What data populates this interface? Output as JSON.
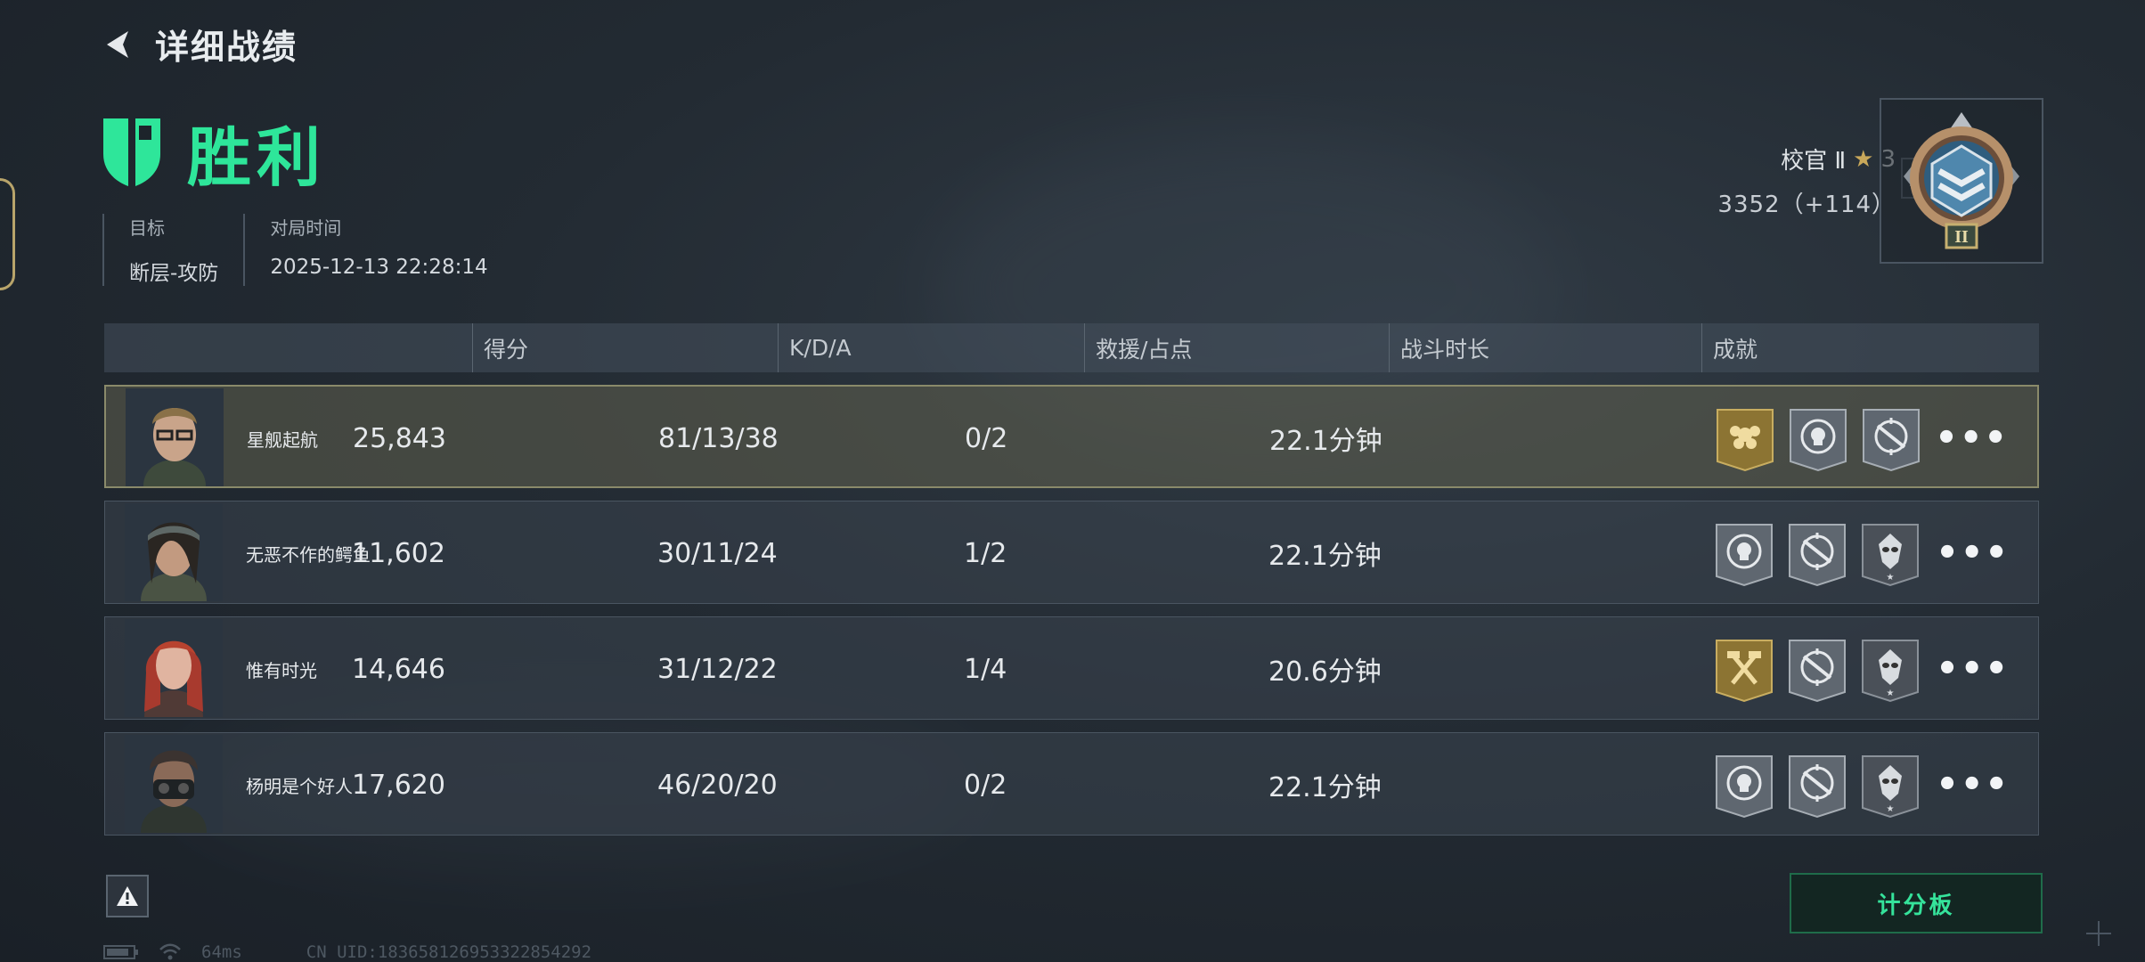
{
  "header": {
    "title": "详细战绩"
  },
  "result": {
    "title": "胜利"
  },
  "meta": {
    "target_label": "目标",
    "target_value": "断层-攻防",
    "time_label": "对局时间",
    "time_value": "2025-12-13 22:28:14"
  },
  "rank": {
    "name": "校官 Ⅱ",
    "stars": "3",
    "points": "3352（+114）",
    "badge_numeral": "II"
  },
  "table": {
    "headers": {
      "score": "得分",
      "kda": "K/D/A",
      "rescue": "救援/占点",
      "duration": "战斗时长",
      "achievements": "成就"
    },
    "rows": [
      {
        "name": "星舰起航",
        "score": "25,843",
        "kda": "81/13/38",
        "rescue": "0/2",
        "duration": "22.1分钟",
        "more": "•••",
        "achievements": [
          "gold-flower-badge-icon",
          "skull-badge-icon",
          "crosshair-badge-icon"
        ]
      },
      {
        "name": "无恶不作的鳄鱼",
        "score": "11,602",
        "kda": "30/11/24",
        "rescue": "1/2",
        "duration": "22.1分钟",
        "more": "•••",
        "achievements": [
          "skull-badge-icon",
          "crosshair-badge-icon",
          "alien-badge-icon"
        ]
      },
      {
        "name": "惟有时光",
        "score": "14,646",
        "kda": "31/12/22",
        "rescue": "1/4",
        "duration": "20.6分钟",
        "more": "•••",
        "achievements": [
          "gold-tools-badge-icon",
          "crosshair-badge-icon",
          "alien-badge-icon"
        ]
      },
      {
        "name": "杨明是个好人",
        "score": "17,620",
        "kda": "46/20/20",
        "rescue": "0/2",
        "duration": "22.1分钟",
        "more": "•••",
        "achievements": [
          "skull-badge-icon",
          "crosshair-badge-icon",
          "alien-badge-icon"
        ]
      }
    ]
  },
  "footer": {
    "scoreboard": "计分板",
    "ping": "64ms",
    "uid": "CN UID:1836581269533228542​92"
  },
  "colors": {
    "accent": "#2ee69a",
    "gold": "#b89a45",
    "highlight_row": "#60604e"
  }
}
